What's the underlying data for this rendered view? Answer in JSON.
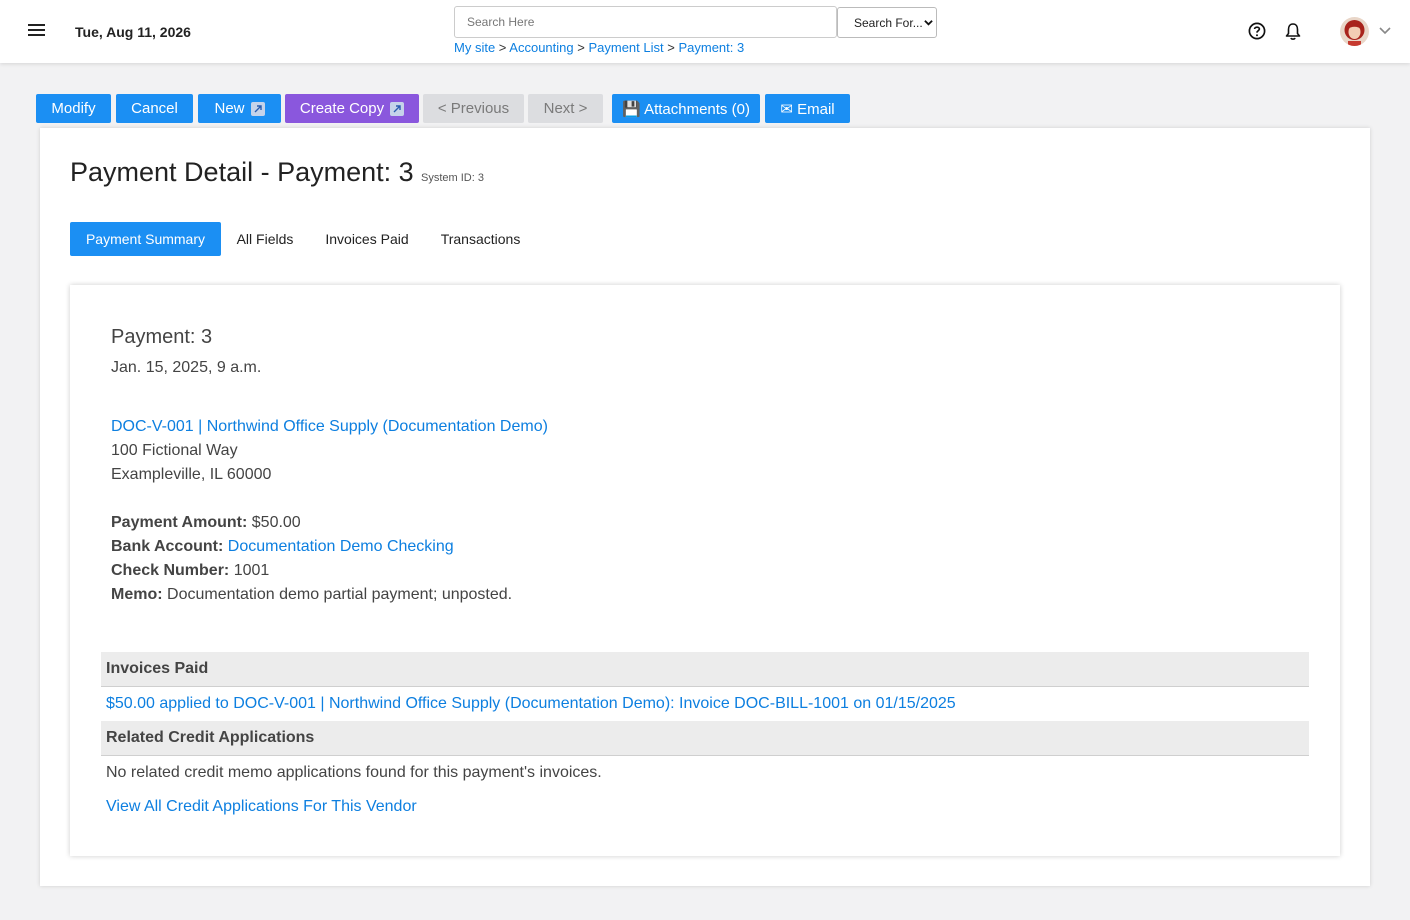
{
  "header": {
    "date": "Tue, Aug 11, 2026",
    "search_placeholder": "Search Here",
    "search_for": "Search For...",
    "breadcrumb": [
      "My site",
      "Accounting",
      "Payment List",
      "Payment: 3"
    ],
    "breadcrumb_sep": ">"
  },
  "toolbar": {
    "modify": "Modify",
    "cancel": "Cancel",
    "new": "New",
    "create_copy": "Create Copy",
    "previous": "< Previous",
    "next": "Next >",
    "attachments": "💾 Attachments (0)",
    "email": "✉ Email"
  },
  "page": {
    "title": "Payment Detail - Payment: 3",
    "system_id": "System ID: 3"
  },
  "tabs": [
    "Payment Summary",
    "All Fields",
    "Invoices Paid",
    "Transactions"
  ],
  "summary": {
    "title": "Payment: 3",
    "date": "Jan. 15, 2025, 9 a.m.",
    "vendor_link": "DOC-V-001 | Northwind Office Supply (Documentation Demo)",
    "address1": "100 Fictional Way",
    "address2": "Exampleville, IL 60000",
    "amount_label": "Payment Amount:",
    "amount": "$50.00",
    "bank_label": "Bank Account:",
    "bank": "Documentation Demo Checking",
    "check_label": "Check Number:",
    "check": "1001",
    "memo_label": "Memo:",
    "memo": "Documentation demo partial payment; unposted."
  },
  "invoices_paid": {
    "heading": "Invoices Paid",
    "item": "$50.00 applied to DOC-V-001 | Northwind Office Supply (Documentation Demo): Invoice DOC-BILL-1001 on 01/15/2025"
  },
  "credit_apps": {
    "heading": "Related Credit Applications",
    "none_text": "No related credit memo applications found for this payment's invoices.",
    "view_all": "View All Credit Applications For This Vendor"
  },
  "colors": {
    "primary": "#1b8ff3",
    "purple": "#8a57dd",
    "link": "#0d7fe0"
  }
}
